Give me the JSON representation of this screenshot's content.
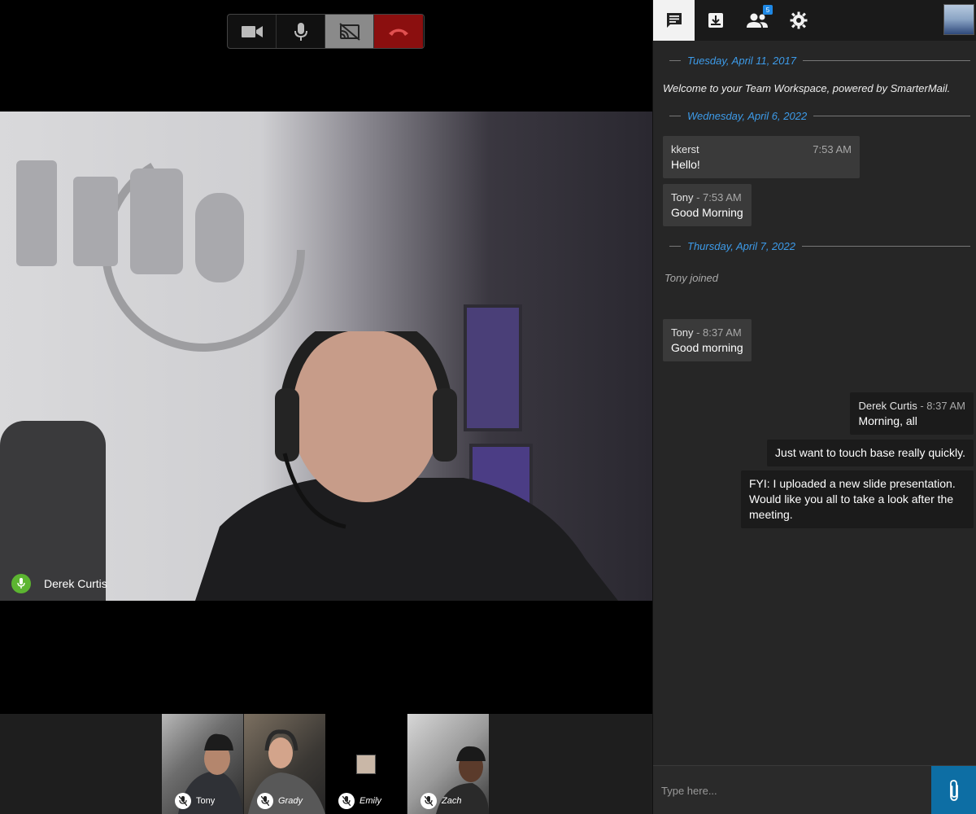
{
  "call_controls": {
    "camera_icon": "video-camera-icon",
    "mic_icon": "microphone-icon",
    "screenshare_icon": "cast-off-icon",
    "hangup_icon": "phone-hangup-icon"
  },
  "main_video": {
    "speaker_name": "Derek Curtis",
    "speaker_mic_icon": "microphone-icon",
    "colors": {
      "mic_active": "#5cb531"
    }
  },
  "participants": [
    {
      "name": "Tony",
      "muted": true
    },
    {
      "name": "Grady",
      "muted": true
    },
    {
      "name": "Emily",
      "muted": true
    },
    {
      "name": "Zach",
      "muted": true
    }
  ],
  "chat": {
    "toolbar": {
      "tabs": [
        {
          "icon": "chat-icon",
          "active": true
        },
        {
          "icon": "download-icon",
          "active": false
        },
        {
          "icon": "people-icon",
          "active": false,
          "badge": "5"
        },
        {
          "icon": "gear-icon",
          "active": false
        }
      ]
    },
    "dates": [
      "Tuesday, April 11, 2017",
      "Wednesday, April 6, 2022",
      "Thursday, April 7, 2022"
    ],
    "welcome": "Welcome to your Team Workspace, powered by SmarterMail.",
    "joined": "Tony joined",
    "messages": [
      {
        "sender": "kkerst",
        "time": "7:53 AM",
        "text": "Hello!"
      },
      {
        "sender": "Tony",
        "sep": " - ",
        "time": "7:53 AM",
        "text": "Good Morning"
      },
      {
        "sender": "Tony",
        "sep": " - ",
        "time": "8:37 AM",
        "text": "Good morning"
      },
      {
        "sender": "Derek Curtis",
        "sep": " - ",
        "time": "8:37 AM",
        "text": "Morning, all"
      },
      {
        "text": "Just want to touch base really quickly."
      },
      {
        "text": "FYI: I uploaded a new slide presentation. Would like you all to take a look after the meeting."
      }
    ],
    "input": {
      "placeholder": "Type here..."
    },
    "colors": {
      "date_accent": "#3d9be9",
      "attach_button": "#0d6ea4",
      "badge": "#1e88e5",
      "hangup": "#8b0f0f"
    }
  }
}
